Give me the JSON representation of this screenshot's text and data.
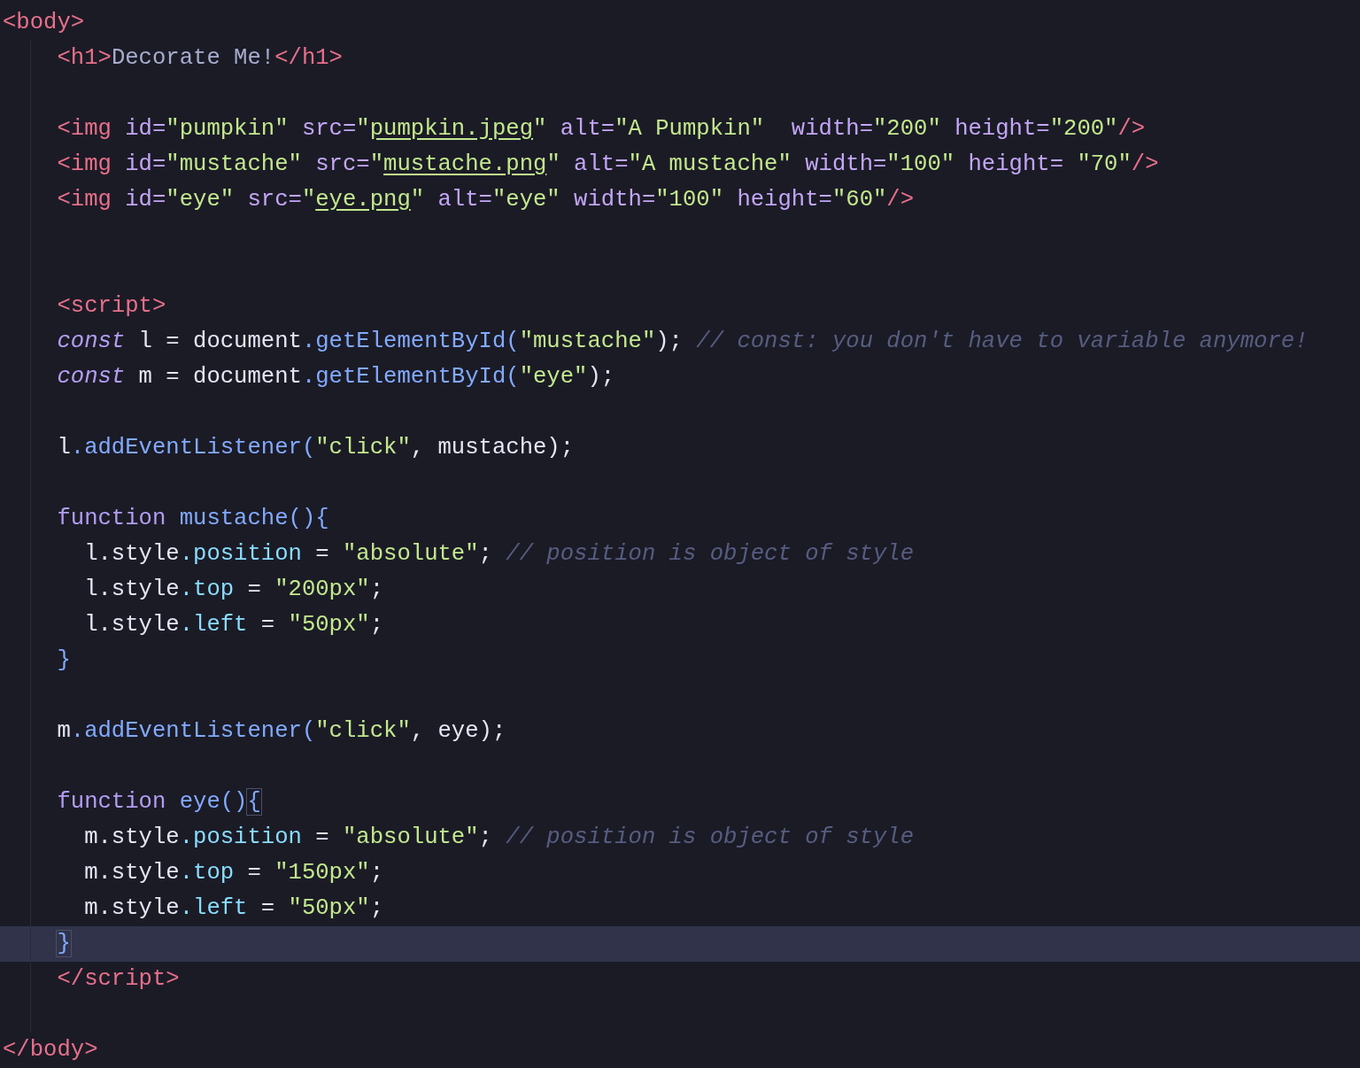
{
  "editor": {
    "lines": [
      {
        "current": false,
        "tokens": [
          {
            "kind": "tag",
            "text": "<body>"
          }
        ]
      },
      {
        "current": false,
        "tokens": [
          {
            "kind": "tag",
            "text": "    <h1>"
          },
          {
            "kind": "content",
            "text": "Decorate Me!"
          },
          {
            "kind": "tag",
            "text": "</h1>"
          }
        ]
      },
      {
        "current": false
      },
      {
        "current": false,
        "tokens": [
          {
            "kind": "tag",
            "text": "    <img"
          },
          {
            "kind": "attr",
            "text": " id="
          },
          {
            "kind": "str",
            "text": "\"pumpkin\""
          },
          {
            "kind": "attr",
            "text": " src="
          },
          {
            "kind": "str",
            "text": "\""
          },
          {
            "kind": "link",
            "text": "pumpkin.jpeg"
          },
          {
            "kind": "str",
            "text": "\""
          },
          {
            "kind": "attr",
            "text": " alt="
          },
          {
            "kind": "str",
            "text": "\"A Pumpkin\""
          },
          {
            "kind": "attr",
            "text": "  width="
          },
          {
            "kind": "str",
            "text": "\"200\""
          },
          {
            "kind": "attr",
            "text": " height="
          },
          {
            "kind": "str",
            "text": "\"200\""
          },
          {
            "kind": "tag",
            "text": "/>"
          }
        ]
      },
      {
        "current": false,
        "tokens": [
          {
            "kind": "tag",
            "text": "    <img"
          },
          {
            "kind": "attr",
            "text": " id="
          },
          {
            "kind": "str",
            "text": "\"mustache\""
          },
          {
            "kind": "attr",
            "text": " src="
          },
          {
            "kind": "str",
            "text": "\""
          },
          {
            "kind": "link",
            "text": "mustache.png"
          },
          {
            "kind": "str",
            "text": "\""
          },
          {
            "kind": "attr",
            "text": " alt="
          },
          {
            "kind": "str",
            "text": "\"A mustache\""
          },
          {
            "kind": "attr",
            "text": " width="
          },
          {
            "kind": "str",
            "text": "\"100\""
          },
          {
            "kind": "attr",
            "text": " height="
          },
          {
            "kind": "str",
            "text": " \"70\""
          },
          {
            "kind": "tag",
            "text": "/>"
          }
        ]
      },
      {
        "current": false,
        "tokens": [
          {
            "kind": "tag",
            "text": "    <img"
          },
          {
            "kind": "attr",
            "text": " id="
          },
          {
            "kind": "str",
            "text": "\"eye\""
          },
          {
            "kind": "attr",
            "text": " src="
          },
          {
            "kind": "str",
            "text": "\""
          },
          {
            "kind": "link",
            "text": "eye.png"
          },
          {
            "kind": "str",
            "text": "\""
          },
          {
            "kind": "attr",
            "text": " alt="
          },
          {
            "kind": "str",
            "text": "\"eye\""
          },
          {
            "kind": "attr",
            "text": " width="
          },
          {
            "kind": "str",
            "text": "\"100\""
          },
          {
            "kind": "attr",
            "text": " height="
          },
          {
            "kind": "str",
            "text": "\"60\""
          },
          {
            "kind": "tag",
            "text": "/>"
          }
        ]
      },
      {
        "current": false
      },
      {
        "current": false
      },
      {
        "current": false,
        "tokens": [
          {
            "kind": "tag",
            "text": "    <script>"
          }
        ]
      },
      {
        "current": false,
        "tokens": [
          {
            "kind": "kw",
            "text": "    const"
          },
          {
            "kind": "text",
            "text": " l = document"
          },
          {
            "kind": "method",
            "text": ".getElementById("
          },
          {
            "kind": "str",
            "text": "\"mustache\""
          },
          {
            "kind": "text",
            "text": ");"
          },
          {
            "kind": "comment",
            "text": " // const: you don't have to variable anymore!"
          }
        ]
      },
      {
        "current": false,
        "tokens": [
          {
            "kind": "kw",
            "text": "    const"
          },
          {
            "kind": "text",
            "text": " m = document"
          },
          {
            "kind": "method",
            "text": ".getElementById("
          },
          {
            "kind": "str",
            "text": "\"eye\""
          },
          {
            "kind": "text",
            "text": ");"
          }
        ]
      },
      {
        "current": false
      },
      {
        "current": false,
        "tokens": [
          {
            "kind": "text",
            "text": "    l"
          },
          {
            "kind": "method",
            "text": ".addEventListener("
          },
          {
            "kind": "str",
            "text": "\"click\""
          },
          {
            "kind": "text",
            "text": ", mustache);"
          }
        ]
      },
      {
        "current": false
      },
      {
        "current": false,
        "tokens": [
          {
            "kind": "fnkw",
            "text": "    function"
          },
          {
            "kind": "method",
            "text": " mustache(){"
          }
        ]
      },
      {
        "current": false,
        "tokens": [
          {
            "kind": "text",
            "text": "      l.style"
          },
          {
            "kind": "prop",
            "text": ".position"
          },
          {
            "kind": "text",
            "text": " = "
          },
          {
            "kind": "str",
            "text": "\"absolute\""
          },
          {
            "kind": "text",
            "text": ";"
          },
          {
            "kind": "comment",
            "text": " // position is object of style"
          }
        ]
      },
      {
        "current": false,
        "tokens": [
          {
            "kind": "text",
            "text": "      l.style"
          },
          {
            "kind": "prop",
            "text": ".top"
          },
          {
            "kind": "text",
            "text": " = "
          },
          {
            "kind": "str",
            "text": "\"200px\""
          },
          {
            "kind": "text",
            "text": ";"
          }
        ]
      },
      {
        "current": false,
        "tokens": [
          {
            "kind": "text",
            "text": "      l.style"
          },
          {
            "kind": "prop",
            "text": ".left"
          },
          {
            "kind": "text",
            "text": " = "
          },
          {
            "kind": "str",
            "text": "\"50px\""
          },
          {
            "kind": "text",
            "text": ";"
          }
        ]
      },
      {
        "current": false,
        "tokens": [
          {
            "kind": "method",
            "text": "    }"
          }
        ]
      },
      {
        "current": false
      },
      {
        "current": false,
        "tokens": [
          {
            "kind": "text",
            "text": "    m"
          },
          {
            "kind": "method",
            "text": ".addEventListener("
          },
          {
            "kind": "str",
            "text": "\"click\""
          },
          {
            "kind": "text",
            "text": ", eye);"
          }
        ]
      },
      {
        "current": false
      },
      {
        "current": false,
        "tokens": [
          {
            "kind": "fnkw",
            "text": "    function"
          },
          {
            "kind": "method",
            "text": " eye()"
          },
          {
            "kind": "match",
            "text": "{"
          }
        ]
      },
      {
        "current": false,
        "tokens": [
          {
            "kind": "text",
            "text": "      m.style"
          },
          {
            "kind": "prop",
            "text": ".position"
          },
          {
            "kind": "text",
            "text": " = "
          },
          {
            "kind": "str",
            "text": "\"absolute\""
          },
          {
            "kind": "text",
            "text": ";"
          },
          {
            "kind": "comment",
            "text": " // position is object of style"
          }
        ]
      },
      {
        "current": false,
        "tokens": [
          {
            "kind": "text",
            "text": "      m.style"
          },
          {
            "kind": "prop",
            "text": ".top"
          },
          {
            "kind": "text",
            "text": " = "
          },
          {
            "kind": "str",
            "text": "\"150px\""
          },
          {
            "kind": "text",
            "text": ";"
          }
        ]
      },
      {
        "current": false,
        "tokens": [
          {
            "kind": "text",
            "text": "      m.style"
          },
          {
            "kind": "prop",
            "text": ".left"
          },
          {
            "kind": "text",
            "text": " = "
          },
          {
            "kind": "str",
            "text": "\"50px\""
          },
          {
            "kind": "text",
            "text": ";"
          }
        ]
      },
      {
        "current": true,
        "tokens": [
          {
            "kind": "match",
            "text": "    }"
          }
        ]
      },
      {
        "current": false,
        "tokens": [
          {
            "kind": "tag",
            "text": "    </script>"
          }
        ]
      },
      {
        "current": false
      },
      {
        "current": false,
        "tokens": [
          {
            "kind": "tag",
            "text": "</body>"
          }
        ]
      }
    ]
  }
}
